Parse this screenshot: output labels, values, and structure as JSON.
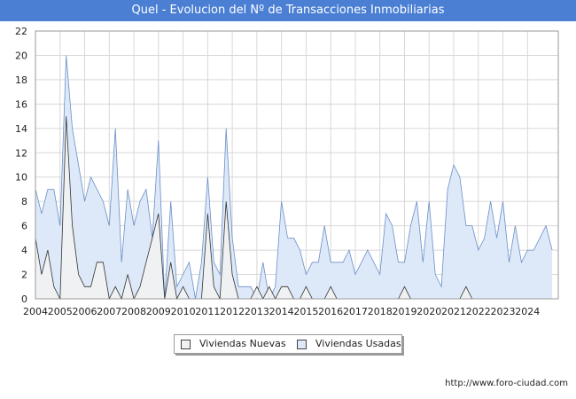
{
  "header": {
    "title": "Quel - Evolucion del Nº de Transacciones Inmobiliarias"
  },
  "footer": {
    "url": "http://www.foro-ciudad.com"
  },
  "chart_data": {
    "type": "area",
    "title": "Quel - Evolucion del Nº de Transacciones Inmobiliarias",
    "xlabel": "",
    "ylabel": "",
    "ylim": [
      0,
      22
    ],
    "yticks": [
      0,
      2,
      4,
      6,
      8,
      10,
      12,
      14,
      16,
      18,
      20,
      22
    ],
    "xlim": [
      2004,
      2025.25
    ],
    "xticks": [
      "2004",
      "2005",
      "2006",
      "2007",
      "2008",
      "2009",
      "2010",
      "2011",
      "2012",
      "2013",
      "2014",
      "2015",
      "2016",
      "2017",
      "2018",
      "2019",
      "2020",
      "2021",
      "2022",
      "2023",
      "2024"
    ],
    "grid": true,
    "legend_position": "bottom",
    "x_unit": "quarter",
    "x_start": "2004 Q1",
    "series": [
      {
        "name": "Viviendas Nuevas",
        "color": "#f2f2f2",
        "stroke": "#333333",
        "values": [
          5,
          2,
          4,
          1,
          0,
          15,
          6,
          2,
          1,
          1,
          3,
          3,
          0,
          1,
          0,
          2,
          0,
          1,
          3,
          5,
          7,
          0,
          3,
          0,
          1,
          0,
          0,
          0,
          7,
          1,
          0,
          8,
          2,
          0,
          0,
          0,
          1,
          0,
          1,
          0,
          1,
          1,
          0,
          0,
          1,
          0,
          0,
          0,
          1,
          0,
          0,
          0,
          0,
          0,
          0,
          0,
          0,
          0,
          0,
          0,
          1,
          0,
          0,
          0,
          0,
          0,
          0,
          0,
          0,
          0,
          1,
          0,
          0,
          0,
          0,
          0,
          0,
          0,
          0,
          0,
          0,
          0,
          0,
          0,
          0,
          0
        ]
      },
      {
        "name": "Viviendas Usadas",
        "color": "#dde9f8",
        "stroke": "#6a8fc8",
        "values": [
          9,
          7,
          9,
          9,
          6,
          20,
          14,
          11,
          8,
          10,
          9,
          8,
          6,
          14,
          3,
          9,
          6,
          8,
          9,
          5,
          13,
          0,
          8,
          1,
          2,
          3,
          0,
          3,
          10,
          3,
          2,
          14,
          5,
          1,
          1,
          1,
          0,
          3,
          0,
          1,
          8,
          5,
          5,
          4,
          2,
          3,
          3,
          6,
          3,
          3,
          3,
          4,
          2,
          3,
          4,
          3,
          2,
          7,
          6,
          3,
          3,
          6,
          8,
          3,
          8,
          2,
          1,
          9,
          11,
          10,
          6,
          6,
          4,
          5,
          8,
          5,
          8,
          3,
          6,
          3,
          4,
          4,
          5,
          6,
          4
        ]
      }
    ]
  }
}
